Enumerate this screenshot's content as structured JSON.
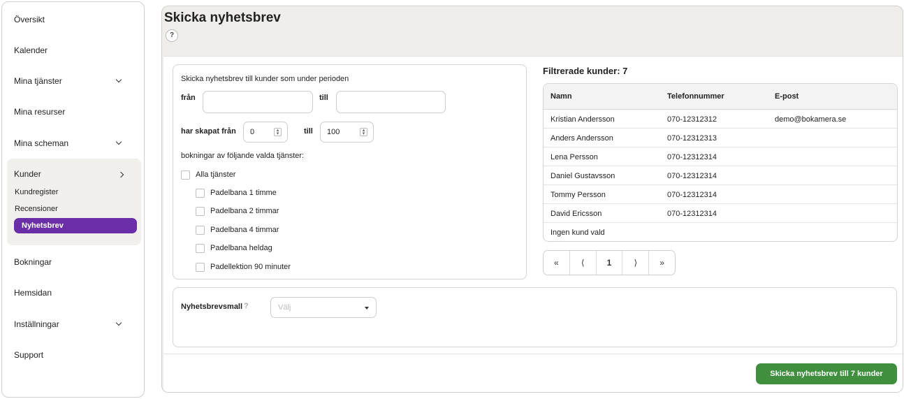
{
  "sidebar": {
    "items": [
      {
        "label": "Översikt",
        "chevron": ""
      },
      {
        "label": "Kalender",
        "chevron": ""
      },
      {
        "label": "Mina tjänster",
        "chevron": "down"
      },
      {
        "label": "Mina resurser",
        "chevron": ""
      },
      {
        "label": "Mina scheman",
        "chevron": "down"
      },
      {
        "label": "Kunder",
        "chevron": "right"
      },
      {
        "label": "Bokningar",
        "chevron": ""
      },
      {
        "label": "Hemsidan",
        "chevron": ""
      },
      {
        "label": "Inställningar",
        "chevron": "down"
      },
      {
        "label": "Support",
        "chevron": ""
      }
    ],
    "kunder_sub": [
      "Kundregister",
      "Recensioner",
      "Nyhetsbrev"
    ],
    "active_sub": "Nyhetsbrev"
  },
  "page": {
    "title": "Skicka nyhetsbrev",
    "help_icon": "?"
  },
  "filter": {
    "intro": "Skicka nyhetsbrev till kunder som under perioden",
    "from_label": "från",
    "to_label": "till",
    "from_value": "",
    "to_value": "",
    "created_from_label": "har skapat från",
    "created_from_value": "0",
    "created_to_label": "till",
    "created_to_value": "100",
    "services_label": "bokningar av följande valda tjänster:",
    "all_services": "Alla tjänster",
    "services": [
      "Padelbana 1 timme",
      "Padelbana 2 timmar",
      "Padelbana 4 timmar",
      "Padelbana heldag",
      "Padellektion 90 minuter"
    ]
  },
  "customers": {
    "heading": "Filtrerade kunder: 7",
    "columns": [
      "Namn",
      "Telefonnummer",
      "E-post"
    ],
    "rows": [
      [
        "Kristian Andersson",
        "070-12312312",
        "demo@bokamera.se"
      ],
      [
        "Anders Andersson",
        "070-12312313",
        ""
      ],
      [
        "Lena Persson",
        "070-12312314",
        ""
      ],
      [
        "Daniel Gustavsson",
        "070-12312314",
        ""
      ],
      [
        "Tommy Persson",
        "070-12312314",
        ""
      ],
      [
        "David Ericsson",
        "070-12312314",
        ""
      ],
      [
        "Ingen kund vald",
        "",
        ""
      ]
    ]
  },
  "pagination": {
    "first": "«",
    "prev": "⟨",
    "current": "1",
    "next": "⟩",
    "last": "»"
  },
  "template": {
    "label": "Nyhetsbrevsmall",
    "help": "?",
    "placeholder": "Välj"
  },
  "send_button": "Skicka nyhetsbrev till 7 kunder",
  "colors": {
    "active_nav": "#6a2fa8",
    "send_button": "#3f8f3f"
  }
}
